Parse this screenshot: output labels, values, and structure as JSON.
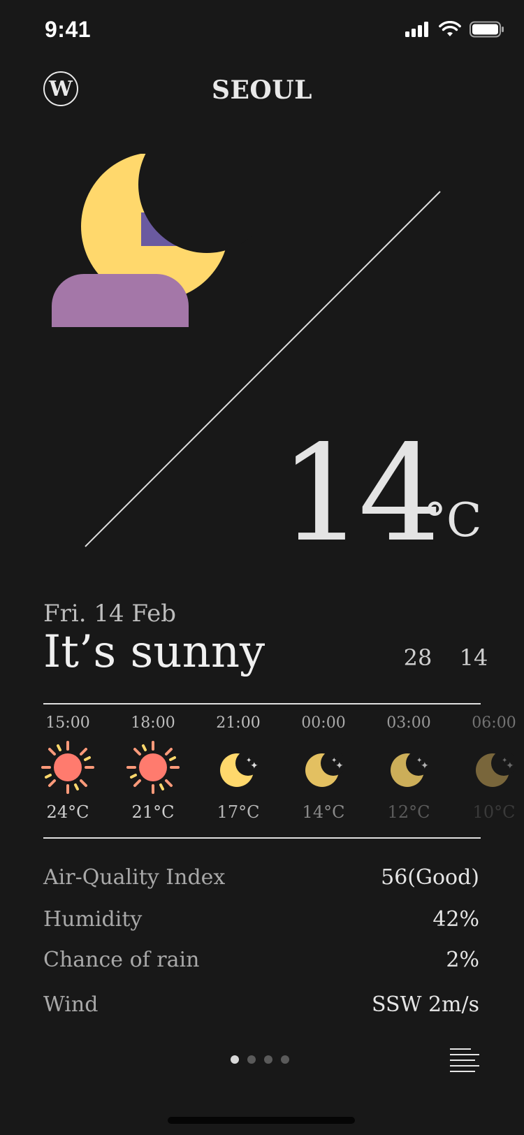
{
  "status_bar": {
    "time": "9:41"
  },
  "header": {
    "logo_letter": "W",
    "city": "SEOUL"
  },
  "current": {
    "temperature": "14",
    "unit": "°C",
    "date": "Fri. 14 Feb",
    "condition": "It’s sunny",
    "high": "28",
    "low": "14",
    "icon": "moon-cloud-icon"
  },
  "hourly": [
    {
      "time": "15:00",
      "icon": "sun-icon",
      "temp": "24°C"
    },
    {
      "time": "18:00",
      "icon": "sun-icon",
      "temp": "21°C"
    },
    {
      "time": "21:00",
      "icon": "moon-icon",
      "temp": "17°C"
    },
    {
      "time": "00:00",
      "icon": "moon-icon",
      "temp": "14°C"
    },
    {
      "time": "03:00",
      "icon": "moon-icon",
      "temp": "12°C"
    },
    {
      "time": "06:00",
      "icon": "moon-icon",
      "temp": "10°C"
    }
  ],
  "stats": [
    {
      "label": "Air-Quality Index",
      "value": "56(Good)"
    },
    {
      "label": "Humidity",
      "value": "42%"
    },
    {
      "label": "Chance of rain",
      "value": "2%"
    },
    {
      "label": "Wind",
      "value": "SSW 2m/s"
    }
  ],
  "pager": {
    "count": 4,
    "active": 0
  },
  "colors": {
    "background": "#181818",
    "moon": "#FFD86C",
    "cloud_back": "#6A5AA0",
    "cloud_front": "#A477A8",
    "sun": "#FF7B6E"
  }
}
